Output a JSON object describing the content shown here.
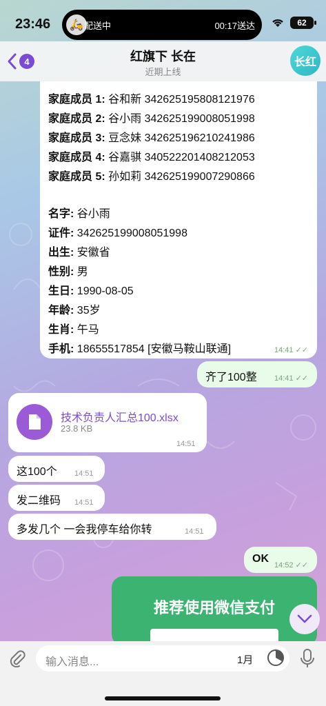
{
  "status": {
    "time": "23:46",
    "island_left": "配送中",
    "island_right": "00:17送达",
    "battery": "62"
  },
  "header": {
    "back_count": "4",
    "title": "红旗下 长在",
    "subtitle": "近期上线",
    "avatar_text": "长红"
  },
  "info_message": {
    "family": [
      {
        "label": "家庭成员 1:",
        "value": " 谷和新  342625195808121976"
      },
      {
        "label": "家庭成员 2:",
        "value": " 谷小雨  342625199008051998"
      },
      {
        "label": "家庭成员 3:",
        "value": " 豆念妹  342625196210241986"
      },
      {
        "label": "家庭成员 4:",
        "value": " 谷嘉骐  340522201408212053"
      },
      {
        "label": "家庭成员 5:",
        "value": " 孙如莉  342625199007290866"
      }
    ],
    "details": [
      {
        "label": "名字:",
        "value": " 谷小雨"
      },
      {
        "label": "证件:",
        "value": " 342625199008051998"
      },
      {
        "label": "出生:",
        "value": " 安徽省"
      },
      {
        "label": "性别:",
        "value": " 男"
      },
      {
        "label": "生日:",
        "value": " 1990-08-05"
      },
      {
        "label": "年龄:",
        "value": " 35岁"
      },
      {
        "label": "生肖:",
        "value": " 午马"
      },
      {
        "label": "手机:",
        "value": " 18655517854 [安徽马鞍山联通]"
      }
    ],
    "time": "14:41"
  },
  "messages": {
    "out1": {
      "text": "齐了100整",
      "time": "14:41"
    },
    "file": {
      "name": "技术负责人汇总100.xlsx",
      "size": "23.8 KB",
      "time": "14:51"
    },
    "in1": {
      "text": "这100个",
      "time": "14:51"
    },
    "in2": {
      "text": "发二维码",
      "time": "14:51"
    },
    "in3": {
      "text": "多发几个 一会我停车给你转",
      "time": "14:51"
    },
    "out2": {
      "text": "OK",
      "time": "14:52"
    },
    "card": {
      "text": "推荐使用微信支付"
    }
  },
  "input": {
    "placeholder": "输入消息...",
    "month": "1月"
  },
  "colors": {
    "accent": "#7b4bd6",
    "outgoing": "#e9fbe9",
    "card_green": "#3cb371"
  }
}
